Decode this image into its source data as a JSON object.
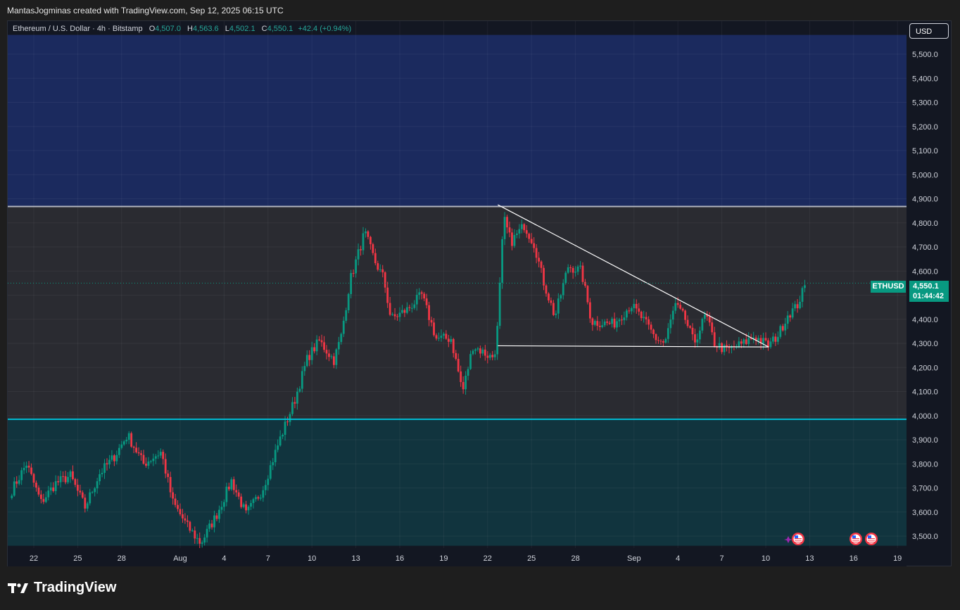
{
  "header": {
    "attribution": "MantasJogminas created with TradingView.com, Sep 12, 2025 06:15 UTC"
  },
  "legend": {
    "title": "Ethereum / U.S. Dollar · 4h · Bitstamp",
    "o_label": "O",
    "o_value": "4,507.0",
    "h_label": "H",
    "h_value": "4,563.6",
    "l_label": "L",
    "l_value": "4,502.1",
    "c_label": "C",
    "c_value": "4,550.1",
    "change": "+42.4 (+0.94%)"
  },
  "currency_button": "USD",
  "symbol_tag": "ETHUSD",
  "price_tag": {
    "price": "4,550.1",
    "countdown": "01:44:42"
  },
  "brand": "TradingView",
  "colors": {
    "up": "#089981",
    "down": "#f23645",
    "upper_zone": "#1b2a5e",
    "middle_zone": "#2a2b31",
    "lower_zone": "#11343e",
    "cyan_line": "#00bcd4"
  },
  "chart_data": {
    "type": "candlestick",
    "symbol": "ETHUSD",
    "timeframe": "4h",
    "ylim": [
      3460,
      5580
    ],
    "y_ticks": [
      "5,500.0",
      "5,400.0",
      "5,300.0",
      "5,200.0",
      "5,100.0",
      "5,000.0",
      "4,900.0",
      "4,800.0",
      "4,700.0",
      "4,600.0",
      "4,500.0",
      "4,400.0",
      "4,300.0",
      "4,200.0",
      "4,100.0",
      "4,000.0",
      "3,900.0",
      "3,800.0",
      "3,700.0",
      "3,600.0",
      "3,500.0"
    ],
    "y_tick_values": [
      5500,
      5400,
      5300,
      5200,
      5100,
      5000,
      4900,
      4800,
      4700,
      4600,
      4500,
      4400,
      4300,
      4200,
      4100,
      4000,
      3900,
      3800,
      3700,
      3600,
      3500
    ],
    "x_ticks": [
      "22",
      "25",
      "28",
      "Aug",
      "4",
      "7",
      "10",
      "13",
      "16",
      "19",
      "22",
      "25",
      "28",
      "Sep",
      "4",
      "7",
      "10",
      "13",
      "16",
      "19"
    ],
    "x_tick_days": [
      -9,
      -6,
      -3,
      1,
      4,
      7,
      10,
      13,
      16,
      19,
      22,
      25,
      28,
      32,
      35,
      38,
      41,
      44,
      47,
      50
    ],
    "zones": [
      {
        "from": 4868,
        "to": 5580
      },
      {
        "from": 3985,
        "to": 4868
      },
      {
        "from": 3460,
        "to": 3985
      }
    ],
    "levels": [
      4868,
      3985
    ],
    "trendlines": [
      {
        "from": [
          22.7,
          4875
        ],
        "to": [
          41.2,
          4285
        ]
      },
      {
        "from": [
          22.7,
          4290
        ],
        "to": [
          41.2,
          4285
        ]
      }
    ],
    "waypoints": [
      [
        -10.5,
        3690
      ],
      [
        -9.5,
        3800
      ],
      [
        -8.5,
        3640
      ],
      [
        -7.5,
        3720
      ],
      [
        -6.5,
        3750
      ],
      [
        -5.5,
        3620
      ],
      [
        -4.5,
        3760
      ],
      [
        -3.5,
        3830
      ],
      [
        -2.6,
        3920
      ],
      [
        -1.5,
        3800
      ],
      [
        -0.3,
        3850
      ],
      [
        0.5,
        3640
      ],
      [
        1.5,
        3540
      ],
      [
        2.4,
        3470
      ],
      [
        3.5,
        3590
      ],
      [
        4.5,
        3730
      ],
      [
        5.5,
        3590
      ],
      [
        6.6,
        3690
      ],
      [
        7.8,
        3900
      ],
      [
        8.8,
        4060
      ],
      [
        9.7,
        4240
      ],
      [
        10.5,
        4310
      ],
      [
        11.5,
        4230
      ],
      [
        12.0,
        4330
      ],
      [
        12.6,
        4560
      ],
      [
        13.6,
        4760
      ],
      [
        14.3,
        4640
      ],
      [
        14.9,
        4570
      ],
      [
        15.4,
        4400
      ],
      [
        16.5,
        4440
      ],
      [
        17.5,
        4500
      ],
      [
        18.5,
        4320
      ],
      [
        19.5,
        4320
      ],
      [
        20.3,
        4100
      ],
      [
        21.0,
        4290
      ],
      [
        22.3,
        4240
      ],
      [
        22.6,
        4290
      ],
      [
        23.1,
        4820
      ],
      [
        23.6,
        4720
      ],
      [
        24.5,
        4790
      ],
      [
        25.2,
        4710
      ],
      [
        25.8,
        4560
      ],
      [
        26.6,
        4410
      ],
      [
        27.5,
        4620
      ],
      [
        28.4,
        4600
      ],
      [
        29.1,
        4390
      ],
      [
        30.6,
        4380
      ],
      [
        31.8,
        4460
      ],
      [
        32.6,
        4400
      ],
      [
        33.5,
        4320
      ],
      [
        34.1,
        4300
      ],
      [
        34.8,
        4460
      ],
      [
        35.5,
        4400
      ],
      [
        36.1,
        4300
      ],
      [
        36.9,
        4420
      ],
      [
        37.5,
        4300
      ],
      [
        38.3,
        4270
      ],
      [
        39.5,
        4300
      ],
      [
        40.2,
        4330
      ],
      [
        41.2,
        4290
      ],
      [
        41.9,
        4340
      ],
      [
        42.5,
        4420
      ],
      [
        43.1,
        4450
      ],
      [
        43.5,
        4510
      ],
      [
        43.8,
        4550
      ]
    ]
  }
}
